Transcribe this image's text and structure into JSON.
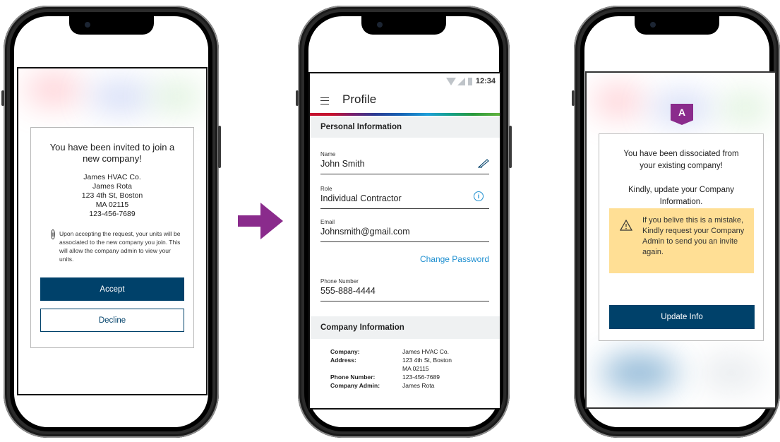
{
  "phone1": {
    "invite_title": "You have been invited to join a new company!",
    "company_name": "James HVAC Co.",
    "contact_name": "James Rota",
    "street": "123 4th St, Boston",
    "state_zip": "MA 02115",
    "phone": "123-456-7689",
    "note": "Upon accepting the request, your units will be associated to the new company you join. This will allow the company admin to view your units.",
    "accept_label": "Accept",
    "decline_label": "Decline"
  },
  "phone2": {
    "status_time": "12:34",
    "title": "Profile",
    "personal_section": "Personal Information",
    "fields": {
      "name_label": "Name",
      "name_value": "John Smith",
      "role_label": "Role",
      "role_value": "Individual Contractor",
      "email_label": "Email",
      "email_value": "Johnsmith@gmail.com",
      "phone_label": "Phone Number",
      "phone_value": "555-888-4444"
    },
    "change_password": "Change Password",
    "company_section": "Company Information",
    "company_info": {
      "company_label": "Company:",
      "address_label": "Address:",
      "phone_label": "Phone Number:",
      "admin_label": "Company Admin:",
      "company_value": "James HVAC Co.",
      "address_line1": "123 4th St, Boston",
      "address_line2": "MA 02115",
      "phone_value": "123-456-7689",
      "admin_value": "James Rota"
    }
  },
  "phone3": {
    "badge": "A",
    "dissociated_msg": "You have been dissociated from your existing company!",
    "update_msg": "Kindly, update your Company Information.",
    "warning": "If you belive this is a mistake, Kindly request your Company Admin to send you an invite again.",
    "update_button": "Update Info"
  },
  "colors": {
    "primary": "#00416a",
    "link": "#1e8fd0",
    "warning_bg": "#ffdf95",
    "arrow": "#8a2b8c"
  }
}
